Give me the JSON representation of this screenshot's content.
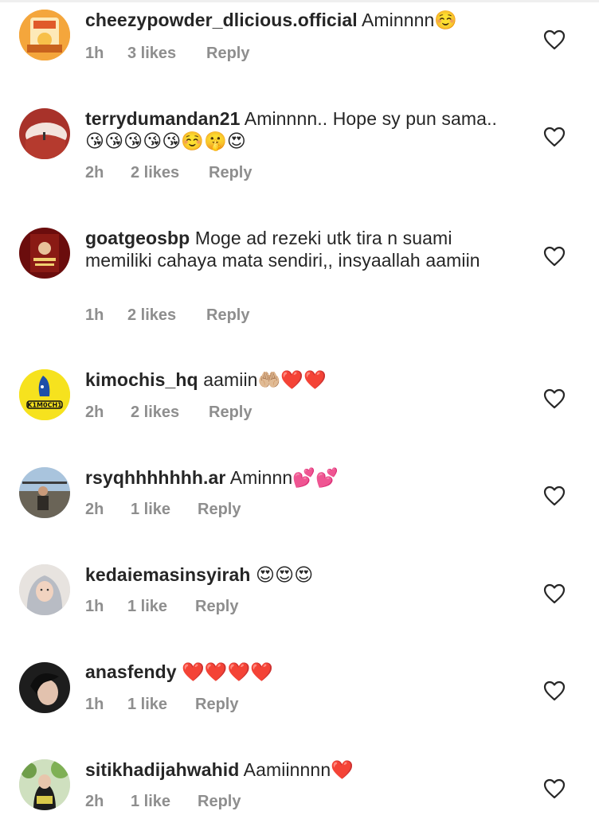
{
  "comments": [
    {
      "username": "cheezypowder_dlicious.official",
      "text": "Aminnnn",
      "emoji": "☺️",
      "time": "1h",
      "likes": "3 likes",
      "reply": "Reply",
      "avatar_icon": "snack-product-avatar"
    },
    {
      "username": "terrydumandan21",
      "text": "Aminnnn.. Hope sy pun sama..",
      "emoji": "😘😘😘😘😘☺️🤫😍",
      "time": "2h",
      "likes": "2 likes",
      "reply": "Reply",
      "avatar_icon": "landscape-avatar"
    },
    {
      "username": "goatgeosbp",
      "text": "Moge ad rezeki utk tira n suami memiliki cahaya mata sendiri,, insyaallah aamiin",
      "emoji": "",
      "time": "1h",
      "likes": "2 likes",
      "reply": "Reply",
      "avatar_icon": "poster-avatar"
    },
    {
      "username": "kimochis_hq",
      "text": "aamiin",
      "emoji": "🤲🏼❤️❤️",
      "time": "2h",
      "likes": "2 likes",
      "reply": "Reply",
      "avatar_icon": "kimochi-logo-avatar"
    },
    {
      "username": "rsyqhhhhhhh.ar",
      "text": "Aminnn",
      "emoji": "💕💕",
      "time": "2h",
      "likes": "1 like",
      "reply": "Reply",
      "avatar_icon": "outdoor-person-avatar"
    },
    {
      "username": "kedaiemasinsyirah",
      "text": "",
      "emoji": "😍😍😍",
      "time": "1h",
      "likes": "1 like",
      "reply": "Reply",
      "avatar_icon": "hijab-person-avatar"
    },
    {
      "username": "anasfendy",
      "text": "",
      "emoji": "❤️❤️❤️❤️",
      "time": "1h",
      "likes": "1 like",
      "reply": "Reply",
      "avatar_icon": "portrait-avatar"
    },
    {
      "username": "sitikhadijahwahid",
      "text": "Aamiinnnn",
      "emoji": "❤️",
      "time": "2h",
      "likes": "1 like",
      "reply": "Reply",
      "avatar_icon": "garden-person-avatar"
    }
  ],
  "colors": {
    "text": "#262626",
    "meta": "#8e8e8e",
    "heart_outline": "#262626"
  }
}
